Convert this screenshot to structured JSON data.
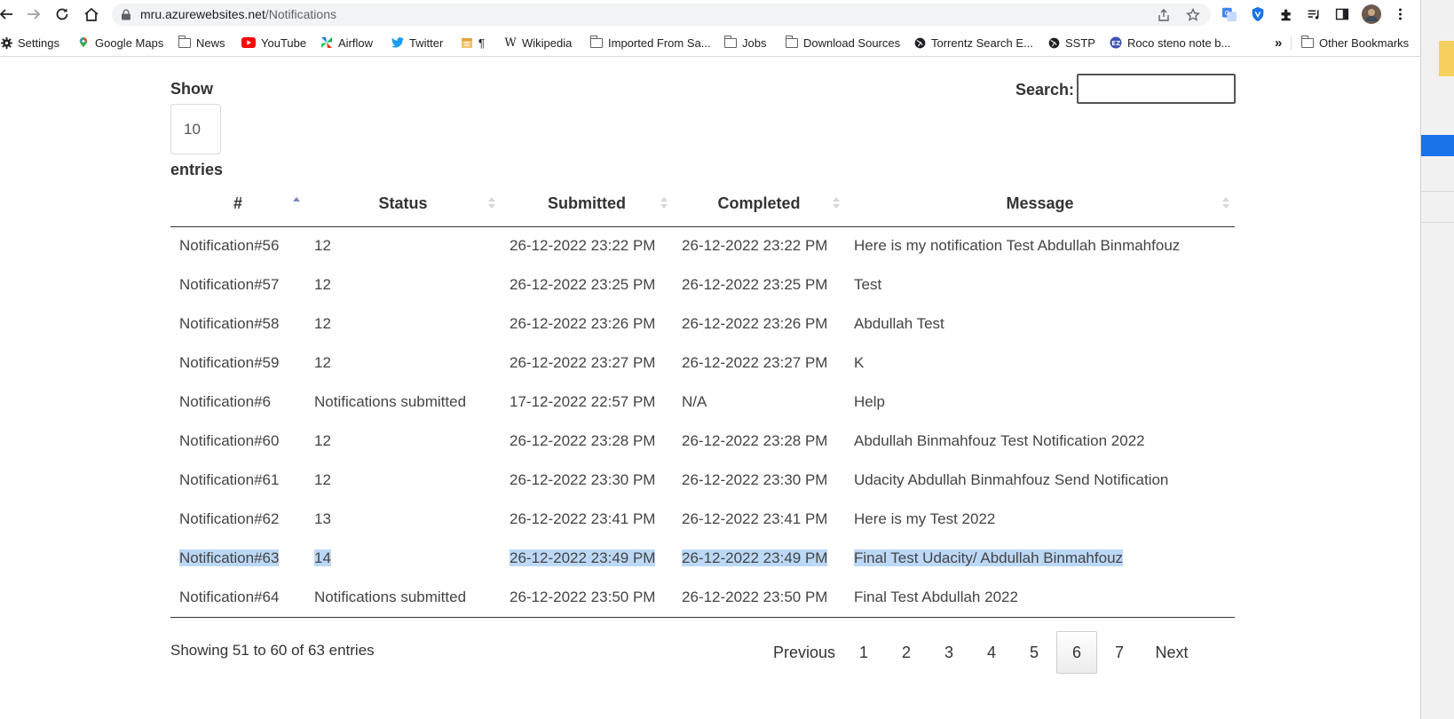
{
  "browser": {
    "url_host": "mru.azurewebsites.net",
    "url_path": "/Notifications"
  },
  "bookmarks": [
    {
      "label": "Settings",
      "icon": "gear-icon"
    },
    {
      "label": "Google Maps",
      "icon": "maps-pin-icon"
    },
    {
      "label": "News",
      "icon": "folder-icon"
    },
    {
      "label": "YouTube",
      "icon": "youtube-icon"
    },
    {
      "label": "Airflow",
      "icon": "airflow-icon"
    },
    {
      "label": "Twitter",
      "icon": "twitter-icon"
    },
    {
      "label": "¶",
      "icon": "paragraph-icon"
    },
    {
      "label": "Wikipedia",
      "icon": "wikipedia-icon"
    },
    {
      "label": "Imported From Sa...",
      "icon": "folder-icon"
    },
    {
      "label": "Jobs",
      "icon": "folder-icon"
    },
    {
      "label": "Download Sources",
      "icon": "folder-icon"
    },
    {
      "label": "Torrentz Search E...",
      "icon": "globe-icon"
    },
    {
      "label": "SSTP",
      "icon": "globe-icon"
    },
    {
      "label": "Roco steno note b...",
      "icon": "ez-icon"
    }
  ],
  "bookmarks_overflow": "»",
  "other_bookmarks": "Other Bookmarks",
  "controls": {
    "show_label": "Show",
    "length_value": "10",
    "entries_label": "entries",
    "search_label": "Search:"
  },
  "table": {
    "columns": [
      "#",
      "Status",
      "Submitted",
      "Completed",
      "Message"
    ],
    "rows": [
      [
        "Notification#56",
        "12",
        "26-12-2022 23:22 PM",
        "26-12-2022 23:22 PM",
        "Here is my notification Test Abdullah Binmahfouz"
      ],
      [
        "Notification#57",
        "12",
        "26-12-2022 23:25 PM",
        "26-12-2022 23:25 PM",
        "Test"
      ],
      [
        "Notification#58",
        "12",
        "26-12-2022 23:26 PM",
        "26-12-2022 23:26 PM",
        "Abdullah Test"
      ],
      [
        "Notification#59",
        "12",
        "26-12-2022 23:27 PM",
        "26-12-2022 23:27 PM",
        "K"
      ],
      [
        "Notification#6",
        "Notifications submitted",
        "17-12-2022 22:57 PM",
        "N/A",
        "Help"
      ],
      [
        "Notification#60",
        "12",
        "26-12-2022 23:28 PM",
        "26-12-2022 23:28 PM",
        "Abdullah Binmahfouz Test Notification 2022"
      ],
      [
        "Notification#61",
        "12",
        "26-12-2022 23:30 PM",
        "26-12-2022 23:30 PM",
        "Udacity Abdullah Binmahfouz Send Notification"
      ],
      [
        "Notification#62",
        "13",
        "26-12-2022 23:41 PM",
        "26-12-2022 23:41 PM",
        "Here is my Test 2022"
      ],
      [
        "Notification#63",
        "14",
        "26-12-2022 23:49 PM",
        "26-12-2022 23:49 PM",
        "Final Test Udacity/ Abdullah Binmahfouz"
      ],
      [
        "Notification#64",
        "Notifications submitted",
        "26-12-2022 23:50 PM",
        "26-12-2022 23:50 PM",
        "Final Test Abdullah 2022"
      ]
    ],
    "selected_row": 8
  },
  "info_text": "Showing 51 to 60 of 63 entries",
  "pagination": {
    "previous": "Previous",
    "pages": [
      "1",
      "2",
      "3",
      "4",
      "5",
      "6",
      "7"
    ],
    "current": "6",
    "next": "Next"
  },
  "colors": {
    "selection": "#bcd8f6",
    "sort_active": "#7b86c4"
  }
}
